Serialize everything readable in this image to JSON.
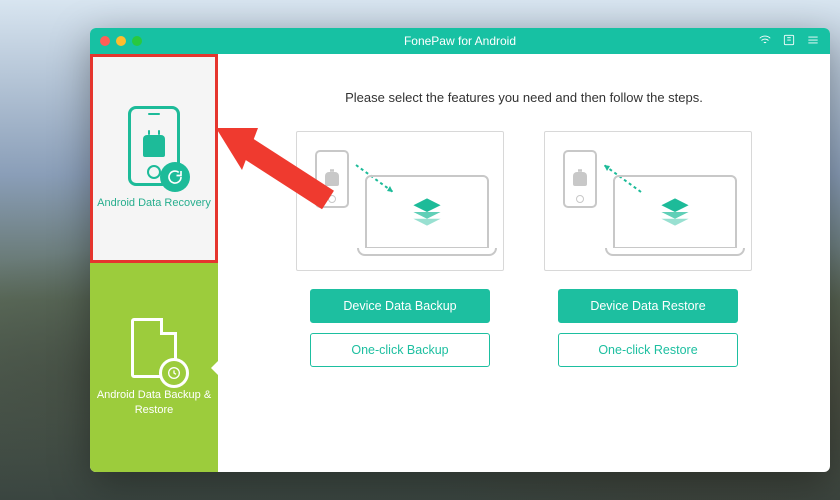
{
  "titlebar": {
    "title": "FonePaw for Android"
  },
  "sidebar": {
    "recovery_label": "Android Data Recovery",
    "backup_label": "Android Data Backup & Restore"
  },
  "main": {
    "instruction": "Please select the features you need and then follow the steps.",
    "backup": {
      "primary": "Device Data Backup",
      "secondary": "One-click Backup"
    },
    "restore": {
      "primary": "Device Data Restore",
      "secondary": "One-click Restore"
    }
  }
}
